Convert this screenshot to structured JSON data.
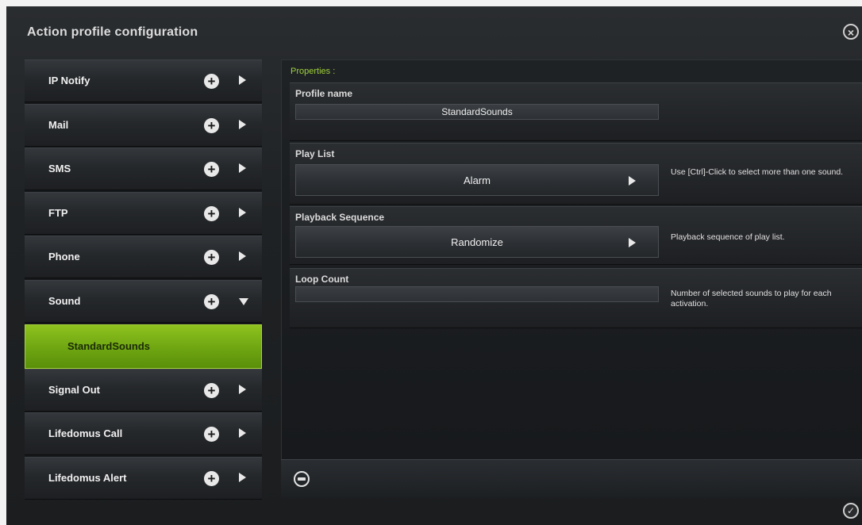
{
  "window": {
    "title": "Action profile configuration",
    "close_icon": "×",
    "ok_icon": "✓"
  },
  "sidebar": {
    "items": [
      {
        "label": "IP Notify",
        "expanded": false
      },
      {
        "label": "Mail",
        "expanded": false
      },
      {
        "label": "SMS",
        "expanded": false
      },
      {
        "label": "FTP",
        "expanded": false
      },
      {
        "label": "Phone",
        "expanded": false
      },
      {
        "label": "Sound",
        "expanded": true
      },
      {
        "label": "Signal Out",
        "expanded": false
      },
      {
        "label": "Lifedomus Call",
        "expanded": false
      },
      {
        "label": "Lifedomus Alert",
        "expanded": false
      }
    ],
    "selected_subitem": "StandardSounds",
    "plus_icon": "+"
  },
  "properties": {
    "title": "Properties :",
    "profile_name": {
      "label": "Profile name",
      "value": "StandardSounds"
    },
    "play_list": {
      "label": "Play List",
      "value": "Alarm",
      "hint": "Use [Ctrl]-Click to select more than one sound."
    },
    "playback_sequence": {
      "label": "Playback Sequence",
      "value": "Randomize",
      "hint": "Playback sequence of play list."
    },
    "loop_count": {
      "label": "Loop Count",
      "value": "",
      "hint": "Number of selected sounds to play for each activation."
    }
  },
  "colors": {
    "accent_green": "#7ab317",
    "properties_title": "#9ed13a"
  }
}
